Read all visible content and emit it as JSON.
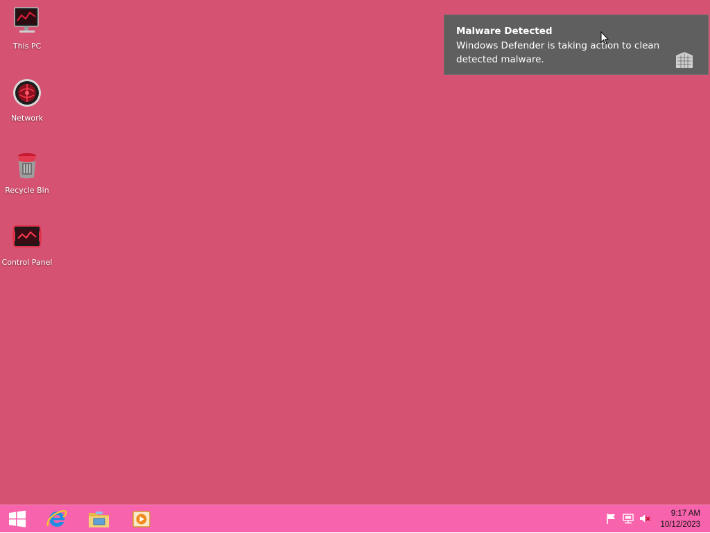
{
  "desktop": {
    "background": "#d65272",
    "icons": [
      {
        "label": "This PC",
        "icon": "monitor-icon"
      },
      {
        "label": "Network",
        "icon": "network-icon"
      },
      {
        "label": "Recycle Bin",
        "icon": "recycle-bin-icon"
      },
      {
        "label": "Control Panel",
        "icon": "control-panel-icon"
      }
    ]
  },
  "notification": {
    "title": "Malware Detected",
    "message": "Windows Defender is taking action to clean detected malware.",
    "icon": "defender-shield-icon",
    "background": "#5f5f5f"
  },
  "taskbar": {
    "background": "#f763ac",
    "pinned": [
      {
        "name": "start",
        "icon": "windows-logo-icon"
      },
      {
        "name": "internet-explorer",
        "icon": "internet-explorer-icon"
      },
      {
        "name": "file-explorer",
        "icon": "folder-icon"
      },
      {
        "name": "media-player",
        "icon": "media-player-icon"
      }
    ],
    "tray": {
      "icons": [
        "action-center-flag-icon",
        "network-status-icon",
        "speaker-muted-icon"
      ],
      "time": "9:17 AM",
      "date": "10/12/2023"
    }
  }
}
